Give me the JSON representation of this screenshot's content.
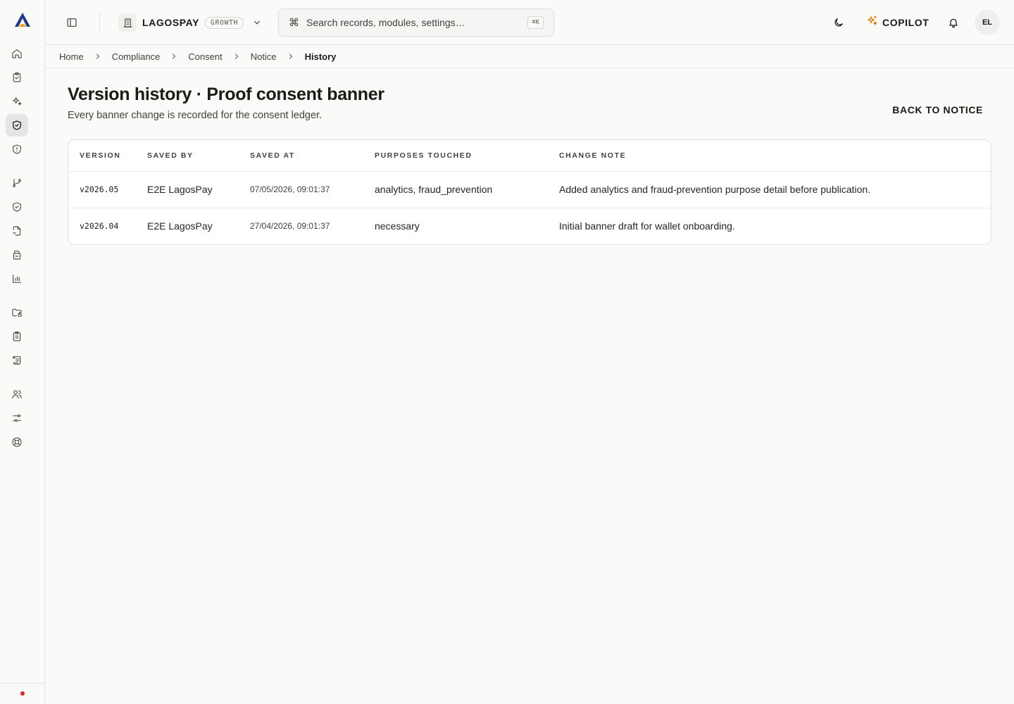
{
  "topbar": {
    "org_name": "LAGOSPAY",
    "plan": "GROWTH",
    "search_placeholder": "Search records, modules, settings…",
    "search_shortcut": "⌘K",
    "copilot_label": "COPILOT",
    "avatar_initials": "EL"
  },
  "breadcrumb": [
    "Home",
    "Compliance",
    "Consent",
    "Notice",
    "History"
  ],
  "page": {
    "title": "Version history · Proof consent banner",
    "subtitle": "Every banner change is recorded for the consent ledger.",
    "back_label": "BACK TO NOTICE"
  },
  "table": {
    "headers": [
      "VERSION",
      "SAVED BY",
      "SAVED AT",
      "PURPOSES TOUCHED",
      "CHANGE NOTE"
    ],
    "rows": [
      {
        "version": "v2026.05",
        "saved_by": "E2E LagosPay",
        "saved_at": "07/05/2026, 09:01:37",
        "purposes": "analytics, fraud_prevention",
        "note": "Added analytics and fraud-prevention purpose detail before publication."
      },
      {
        "version": "v2026.04",
        "saved_by": "E2E LagosPay",
        "saved_at": "27/04/2026, 09:01:37",
        "purposes": "necessary",
        "note": "Initial banner draft for wallet onboarding."
      }
    ]
  },
  "icons": {
    "rail": [
      "home-icon",
      "clipboard-check-icon",
      "sparkles-icon",
      "shield-check-icon",
      "shield-alert-icon",
      "git-branch-icon",
      "shield-icon",
      "file-signature-icon",
      "file-stack-icon",
      "bar-chart-icon",
      "folder-lock-icon",
      "clipboard-list-icon",
      "scroll-icon",
      "users-icon",
      "sliders-icon",
      "lifebuoy-icon"
    ]
  },
  "colors": {
    "brand_dark": "#1e2a4a",
    "brand_accent": "#f59e0b",
    "status_dot": "#dc2626",
    "copilot_accent": "#d97706"
  }
}
